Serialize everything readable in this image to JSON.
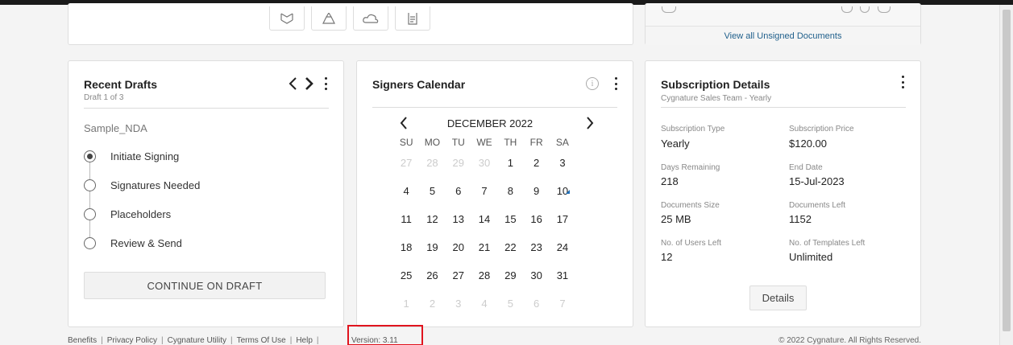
{
  "unsigned": {
    "view_all": "View all Unsigned Documents"
  },
  "drafts": {
    "title": "Recent Drafts",
    "counter": "Draft 1 of 3",
    "doc_name": "Sample_NDA",
    "steps": [
      {
        "label": "Initiate Signing",
        "checked": true
      },
      {
        "label": "Signatures Needed",
        "checked": false
      },
      {
        "label": "Placeholders",
        "checked": false
      },
      {
        "label": "Review & Send",
        "checked": false
      }
    ],
    "continue_label": "CONTINUE ON DRAFT"
  },
  "calendar": {
    "title": "Signers Calendar",
    "info_glyph": "i",
    "month": "DECEMBER 2022",
    "weekdays": [
      "SU",
      "MO",
      "TU",
      "WE",
      "TH",
      "FR",
      "SA"
    ],
    "weeks": [
      [
        "27",
        "28",
        "29",
        "30",
        "1",
        "2",
        "3"
      ],
      [
        "4",
        "5",
        "6",
        "7",
        "8",
        "9",
        "10"
      ],
      [
        "11",
        "12",
        "13",
        "14",
        "15",
        "16",
        "17"
      ],
      [
        "18",
        "19",
        "20",
        "21",
        "22",
        "23",
        "24"
      ],
      [
        "25",
        "26",
        "27",
        "28",
        "29",
        "30",
        "31"
      ],
      [
        "1",
        "2",
        "3",
        "4",
        "5",
        "6",
        "7"
      ]
    ],
    "muted": [
      [
        0,
        0
      ],
      [
        0,
        1
      ],
      [
        0,
        2
      ],
      [
        0,
        3
      ],
      [
        5,
        0
      ],
      [
        5,
        1
      ],
      [
        5,
        2
      ],
      [
        5,
        3
      ],
      [
        5,
        4
      ],
      [
        5,
        5
      ],
      [
        5,
        6
      ]
    ],
    "marked_day": "9",
    "marker_color": "#1f6fb8"
  },
  "subscription": {
    "title": "Subscription Details",
    "plan": "Cygnature Sales Team - Yearly",
    "type_label": "Subscription Type",
    "type_value": "Yearly",
    "price_label": "Subscription Price",
    "price_value": "$120.00",
    "days_label": "Days Remaining",
    "days_value": "218",
    "end_label": "End Date",
    "end_value": "15-Jul-2023",
    "size_label": "Documents Size",
    "size_value": "25 MB",
    "docs_left_label": "Documents Left",
    "docs_left_value": "1152",
    "users_label": "No. of Users Left",
    "users_value": "12",
    "templates_label": "No. of Templates Left",
    "templates_value": "Unlimited",
    "details_label": "Details"
  },
  "footer": {
    "links": [
      "Benefits",
      "Privacy Policy",
      "Cygnature Utility",
      "Terms Of Use",
      "Help"
    ],
    "version": "Version: 3.11",
    "copyright": "© 2022 Cygnature. All Rights Reserved."
  },
  "colors": {
    "highlight": "#e0141e",
    "link": "#1f5f8b"
  }
}
